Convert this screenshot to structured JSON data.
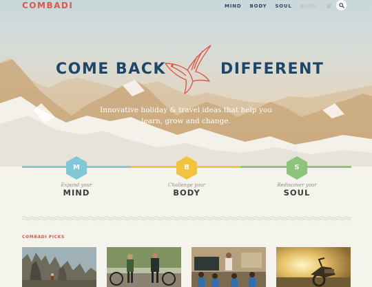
{
  "brand": {
    "logo": "COMBADI"
  },
  "nav": {
    "items": [
      {
        "label": "MIND"
      },
      {
        "label": "BODY"
      },
      {
        "label": "SOUL"
      },
      {
        "label": "BLOG"
      }
    ],
    "social": [
      "twitter-icon",
      "facebook-icon"
    ],
    "search_icon": "search-icon"
  },
  "hero": {
    "headline_left": "COME BACK",
    "headline_right": "DIFFERENT",
    "tagline_line1": "Innovative holiday & travel ideas that help you",
    "tagline_line2": "learn, grow and change.",
    "logo_icon": "swallow-bird-icon"
  },
  "pillars": [
    {
      "letter": "M",
      "subtitle": "Expand your",
      "title": "MIND",
      "color": "#7ec8d8"
    },
    {
      "letter": "B",
      "subtitle": "Challenge your",
      "title": "BODY",
      "color": "#f2c43d"
    },
    {
      "letter": "S",
      "subtitle": "Rediscover your",
      "title": "SOUL",
      "color": "#8cc57a"
    }
  ],
  "picks": {
    "label": "COMBADI PICKS",
    "thumbnails": [
      "rock-formation-photo",
      "cyclists-photo",
      "classroom-photo",
      "motorcycle-photo"
    ]
  },
  "colors": {
    "accent": "#e0574a",
    "navy": "#1f4567",
    "background": "#f4f3ec"
  }
}
